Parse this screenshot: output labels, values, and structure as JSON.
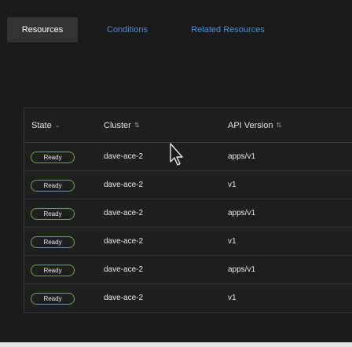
{
  "tabs": [
    {
      "label": "Resources",
      "active": true
    },
    {
      "label": "Conditions",
      "active": false
    },
    {
      "label": "Related Resources",
      "active": false
    }
  ],
  "table": {
    "columns": [
      {
        "label": "State",
        "sort_icon": "chevron-down-icon"
      },
      {
        "label": "Cluster",
        "sort_icon": "sort-icon"
      },
      {
        "label": "API Version",
        "sort_icon": "sort-icon"
      }
    ],
    "rows": [
      {
        "state": "Ready",
        "cluster": "dave-ace-2",
        "api_version": "apps/v1"
      },
      {
        "state": "Ready",
        "cluster": "dave-ace-2",
        "api_version": "v1"
      },
      {
        "state": "Ready",
        "cluster": "dave-ace-2",
        "api_version": "apps/v1"
      },
      {
        "state": "Ready",
        "cluster": "dave-ace-2",
        "api_version": "v1"
      },
      {
        "state": "Ready",
        "cluster": "dave-ace-2",
        "api_version": "apps/v1"
      },
      {
        "state": "Ready",
        "cluster": "dave-ace-2",
        "api_version": "v1"
      }
    ]
  },
  "colors": {
    "tab_link": "#4a90d6",
    "ready_border": "#6aa84f",
    "background": "#1b1b1b"
  }
}
